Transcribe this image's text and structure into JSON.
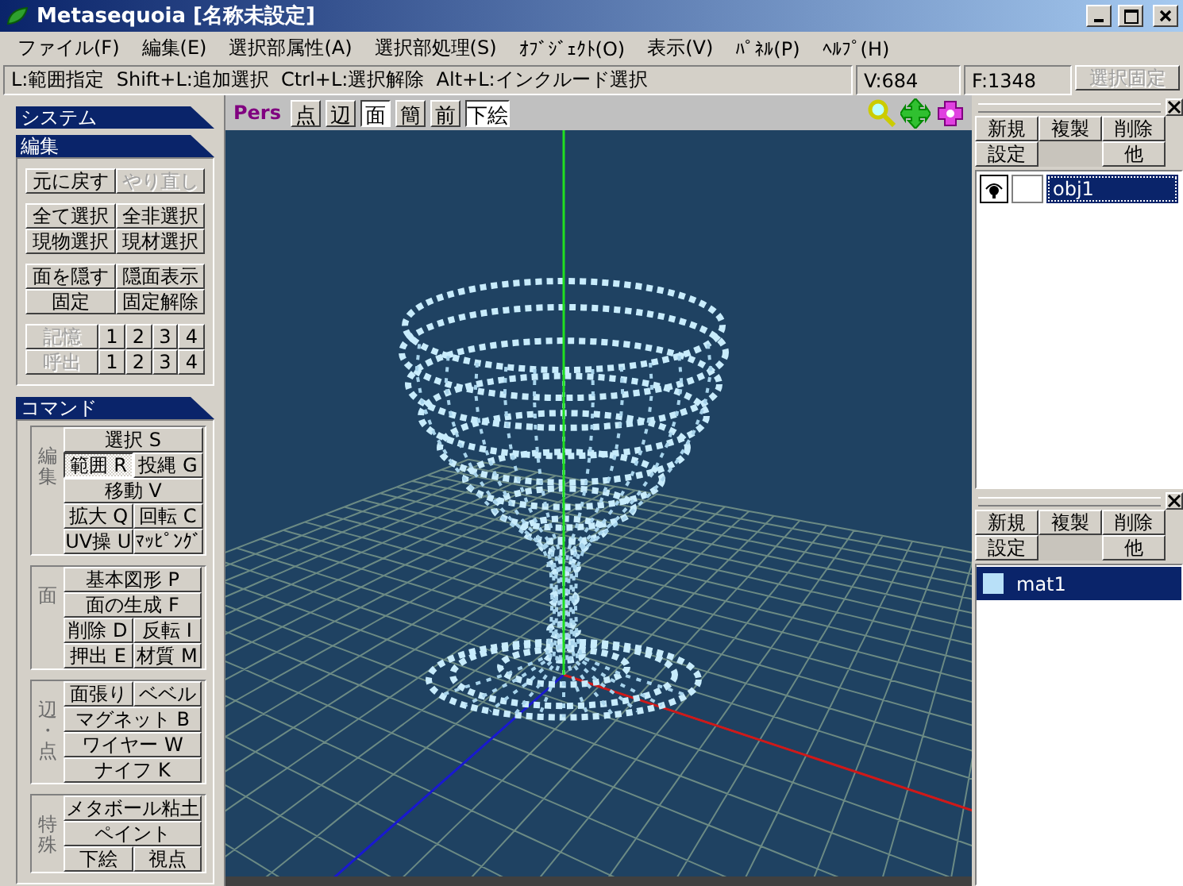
{
  "window": {
    "title": "Metasequoia [名称未設定]"
  },
  "menu": [
    "ファイル(F)",
    "編集(E)",
    "選択部属性(A)",
    "選択部処理(S)",
    "ｵﾌﾞｼﾞｪｸﾄ(O)",
    "表示(V)",
    "ﾊﾟﾈﾙ(P)",
    "ﾍﾙﾌﾟ(H)"
  ],
  "status_bar": {
    "hint": "L:範囲指定  Shift+L:追加選択  Ctrl+L:選択解除  Alt+L:インクルード選択",
    "vertices": "V:684",
    "faces": "F:1348",
    "lock_button": {
      "label": "選択固定",
      "disabled": true
    }
  },
  "left_panel": {
    "system_header": "システム",
    "edit": {
      "header": "編集",
      "groups": [
        [
          [
            {
              "label": "元に戻す",
              "disabled": false
            },
            {
              "label": "やり直し",
              "disabled": true
            }
          ]
        ],
        [
          [
            {
              "label": "全て選択",
              "disabled": false
            },
            {
              "label": "全非選択",
              "disabled": false
            }
          ],
          [
            {
              "label": "現物選択",
              "disabled": false
            },
            {
              "label": "現材選択",
              "disabled": false
            }
          ]
        ],
        [
          [
            {
              "label": "面を隠す",
              "disabled": false
            },
            {
              "label": "隠面表示",
              "disabled": false
            }
          ],
          [
            {
              "label": "固定",
              "disabled": false
            },
            {
              "label": "固定解除",
              "disabled": false
            }
          ]
        ],
        [
          [
            {
              "label": "記憶",
              "disabled": true
            },
            {
              "label": "1",
              "disabled": false
            },
            {
              "label": "2",
              "disabled": false
            },
            {
              "label": "3",
              "disabled": false
            },
            {
              "label": "4",
              "disabled": false
            }
          ],
          [
            {
              "label": "呼出",
              "disabled": true
            },
            {
              "label": "1",
              "disabled": false
            },
            {
              "label": "2",
              "disabled": false
            },
            {
              "label": "3",
              "disabled": false
            },
            {
              "label": "4",
              "disabled": false
            }
          ]
        ]
      ]
    },
    "command": {
      "header": "コマンド",
      "groups": [
        {
          "label": "編集",
          "rows": [
            [
              {
                "label": "選択 S",
                "selected": false
              }
            ],
            [
              {
                "label": "範囲 R",
                "selected": true
              },
              {
                "label": "投縄 G",
                "selected": false
              }
            ],
            [
              {
                "label": "移動 V",
                "selected": false
              }
            ],
            [
              {
                "label": "拡大 Q",
                "selected": false
              },
              {
                "label": "回転 C",
                "selected": false
              }
            ],
            [
              {
                "label": "UV操 U",
                "selected": false
              },
              {
                "label": "ﾏｯﾋﾟﾝｸﾞ",
                "selected": false
              }
            ]
          ]
        },
        {
          "label": "面",
          "rows": [
            [
              {
                "label": "基本図形 P",
                "selected": false
              }
            ],
            [
              {
                "label": "面の生成 F",
                "selected": false
              }
            ],
            [
              {
                "label": "削除 D",
                "selected": false
              },
              {
                "label": "反転 I",
                "selected": false
              }
            ],
            [
              {
                "label": "押出 E",
                "selected": false
              },
              {
                "label": "材質 M",
                "selected": false
              }
            ]
          ]
        },
        {
          "label": "辺・点",
          "rows": [
            [
              {
                "label": "面張り",
                "selected": false
              },
              {
                "label": "ベベル",
                "selected": false
              }
            ],
            [
              {
                "label": "マグネット B",
                "selected": false
              }
            ],
            [
              {
                "label": "ワイヤー W",
                "selected": false
              }
            ],
            [
              {
                "label": "ナイフ K",
                "selected": false
              }
            ]
          ]
        },
        {
          "label": "特殊",
          "rows": [
            [
              {
                "label": "メタボール粘土",
                "selected": false
              }
            ],
            [
              {
                "label": "ペイント",
                "selected": false
              }
            ],
            [
              {
                "label": "下絵",
                "selected": false
              },
              {
                "label": "視点",
                "selected": false
              }
            ]
          ]
        }
      ]
    }
  },
  "viewport": {
    "projection": "Pers",
    "view_buttons": [
      {
        "label": "点",
        "selected": false
      },
      {
        "label": "辺",
        "selected": false
      },
      {
        "label": "面",
        "selected": true
      },
      {
        "label": "簡",
        "selected": false
      },
      {
        "label": "前",
        "selected": false
      },
      {
        "label": "下絵",
        "selected": true
      }
    ]
  },
  "object_panel": {
    "buttons": [
      "新規",
      "複製",
      "削除",
      "設定",
      "他"
    ],
    "items": [
      {
        "name": "obj1",
        "visible": true,
        "selected": true
      }
    ]
  },
  "material_panel": {
    "buttons": [
      "新規",
      "複製",
      "削除",
      "設定",
      "他"
    ],
    "items": [
      {
        "name": "mat1",
        "color": "#b8e0f8",
        "selected": true
      }
    ]
  }
}
